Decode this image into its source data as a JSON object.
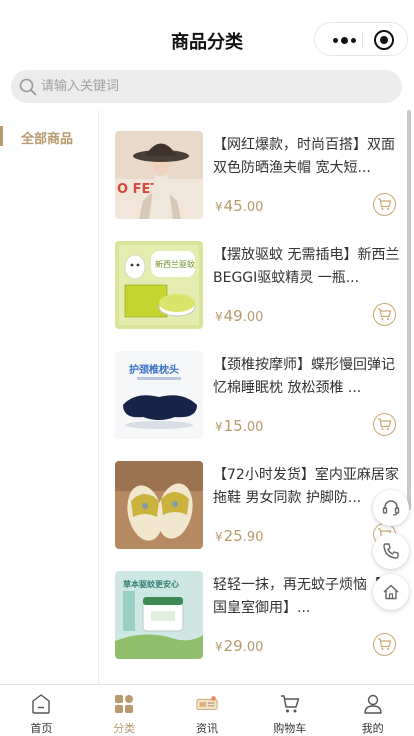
{
  "header": {
    "title": "商品分类"
  },
  "search": {
    "placeholder": "请输入关键词"
  },
  "sidebar": {
    "items": [
      {
        "label": "全部商品",
        "active": true
      }
    ]
  },
  "products": [
    {
      "name": "【网红爆款，时尚百搭】双面双色防晒渔夫帽 宽大短...",
      "currency": "¥",
      "price_int": "45",
      "price_dec": ".00",
      "thumb_text": ""
    },
    {
      "name": "【摆放驱蚊 无需插电】新西兰BEGGI驱蚊精灵 一瓶...",
      "currency": "¥",
      "price_int": "49",
      "price_dec": ".00",
      "thumb_text": "新西兰驱蚊"
    },
    {
      "name": "【颈椎按摩师】蝶形慢回弹记忆棉睡眠枕 放松颈椎 ...",
      "currency": "¥",
      "price_int": "15",
      "price_dec": ".00",
      "thumb_text": "护颈椎枕头"
    },
    {
      "name": "【72小时发货】室内亚麻居家拖鞋 男女同款 护脚防...",
      "currency": "¥",
      "price_int": "25",
      "price_dec": ".90",
      "thumb_text": ""
    },
    {
      "name": "轻轻一抹，再无蚊子烦恼【泰国皇室御用】...",
      "currency": "¥",
      "price_int": "29",
      "price_dec": ".00",
      "thumb_text": "草本驱蚊更安心"
    }
  ],
  "tabbar": {
    "items": [
      {
        "label": "首页",
        "icon": "home-icon"
      },
      {
        "label": "分类",
        "icon": "category-icon",
        "active": true
      },
      {
        "label": "资讯",
        "icon": "news-icon"
      },
      {
        "label": "购物车",
        "icon": "cart-icon"
      },
      {
        "label": "我的",
        "icon": "user-icon"
      }
    ]
  },
  "colors": {
    "accent": "#b79a6d",
    "search_bg": "#ececec",
    "border": "#ededed"
  }
}
